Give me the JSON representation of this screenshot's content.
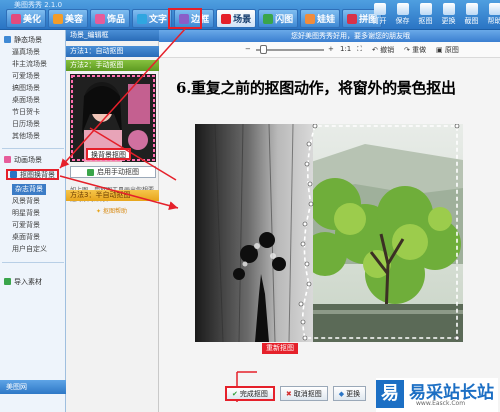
{
  "app": {
    "title": "美图秀秀 2.1.0"
  },
  "nav_tabs": [
    {
      "label": "美化",
      "color": "#e34b7e"
    },
    {
      "label": "美容",
      "color": "#f19c2a"
    },
    {
      "label": "饰品",
      "color": "#e65c9a"
    },
    {
      "label": "文字",
      "color": "#2fa6e0"
    },
    {
      "label": "边框",
      "color": "#8a5ec8"
    },
    {
      "label": "场景",
      "color": "#e5202a",
      "active": true
    },
    {
      "label": "闪图",
      "color": "#3aa54a"
    },
    {
      "label": "娃娃",
      "color": "#f08c3c"
    },
    {
      "label": "拼图",
      "color": "#d8324a"
    }
  ],
  "right_tools": [
    "打开",
    "保存",
    "抠图",
    "更换",
    "截图",
    "帮助"
  ],
  "sidebar": {
    "static_title": "静态场景",
    "static_items": [
      "逼真场景",
      "非主流场景",
      "可爱场景",
      "搞图场景",
      "桌面场景",
      "节日贺卡",
      "日历场景",
      "其他场景"
    ],
    "animated_title": "动画场景",
    "cutout_title": "抠图换背景",
    "cutout_items": [
      "杂志背景",
      "风景背景",
      "明星背景",
      "可爱背景",
      "桌面背景",
      "用户自定义"
    ],
    "import_label": "导入素材",
    "bottom_label": "美图网"
  },
  "methods": {
    "header": "场景_编辑框",
    "method1": "方法1：自动抠图",
    "method2": "方法2：手动抠图",
    "thumb_label": "换背景抠图",
    "manual_button": "启用手动抠图",
    "method2_desc": "如上图，用抠图工具画出你想要抠的景的部分。",
    "help": "抠图帮助",
    "method3": "方法3：半自动抠图"
  },
  "editor": {
    "hint": "您好美图秀秀好用，要多谢您的朋友哦",
    "zoom_label": "1:1",
    "tools": [
      "撤销",
      "重做",
      "原图"
    ],
    "instruction": "6.重复之前的抠图动作，将窗外的景色抠出",
    "redo_label": "重新抠图",
    "buttons": {
      "done": "完成抠图",
      "cancel": "取消抠图",
      "replace": "更换"
    }
  },
  "watermark": {
    "logo": "易",
    "name": "易采站长站",
    "url": "www.Easck.Com"
  }
}
